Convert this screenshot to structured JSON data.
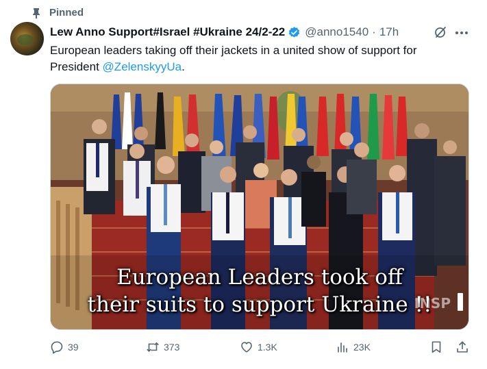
{
  "pinned": {
    "label": "Pinned"
  },
  "author": {
    "display_name": "Lew Anno Support#Israel #Ukraine 24/2-22",
    "handle": "@anno1540",
    "separator": "·",
    "time": "17h"
  },
  "tweet": {
    "text_before": "European leaders taking off their jackets in a united show of support for President ",
    "mention": "@ZelenskyyUa",
    "text_after": "."
  },
  "media": {
    "caption_line1": "European Leaders took off",
    "caption_line2": "their suits to support Ukraine !!",
    "watermark": "INSP"
  },
  "actions": {
    "replies": "39",
    "reposts": "373",
    "likes": "1.3K",
    "views": "23K"
  },
  "colors": {
    "accent": "#1d9bf0",
    "secondary_text": "#536471",
    "primary_text": "#0f1419"
  },
  "icons": [
    "pin-icon",
    "verified-badge-icon",
    "grok-icon",
    "more-icon",
    "reply-icon",
    "repost-icon",
    "like-icon",
    "views-icon",
    "bookmark-icon",
    "share-icon"
  ]
}
